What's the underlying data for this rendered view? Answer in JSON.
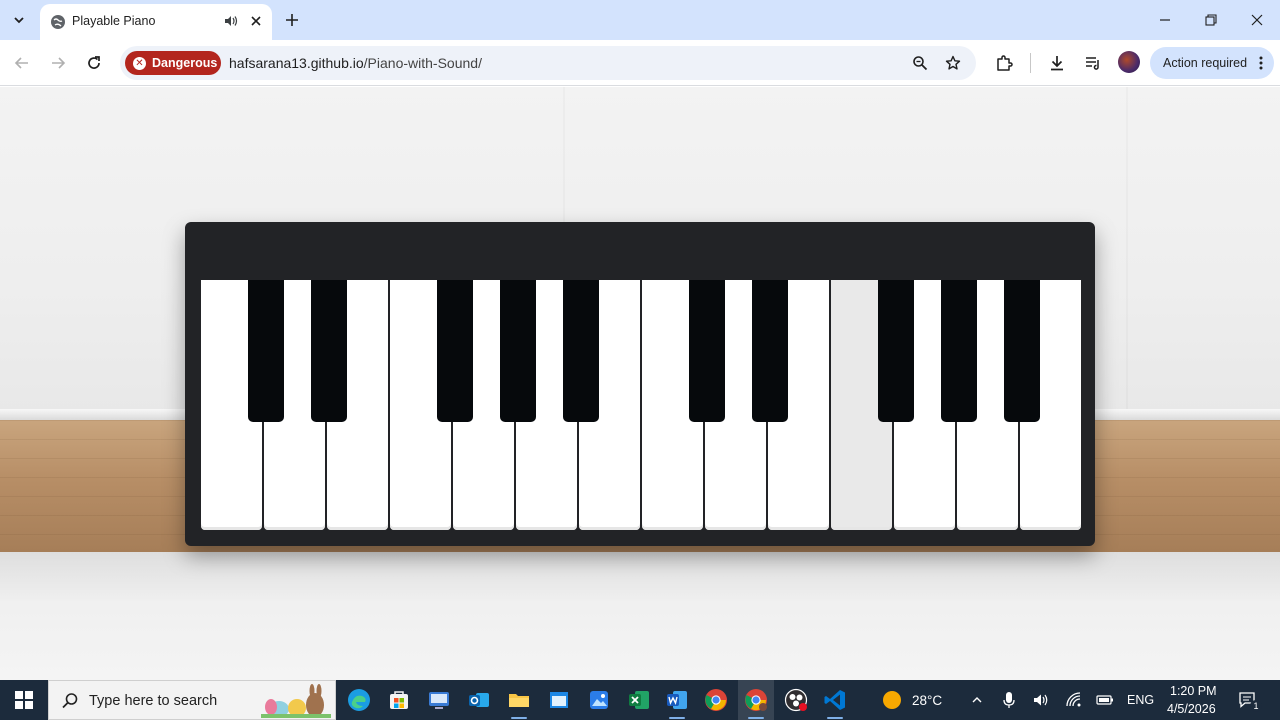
{
  "browser": {
    "tab": {
      "title": "Playable Piano"
    },
    "omnibox": {
      "security_label": "Dangerous",
      "url_host": "hafsarana13.github.io",
      "url_path": "/Piano-with-Sound/"
    },
    "action_pill": {
      "label": "Action required"
    }
  },
  "piano": {
    "white_keys": 14,
    "black_key_positions": [
      0,
      1,
      3,
      4,
      5,
      7,
      8,
      10,
      11,
      12
    ],
    "active_white_key": 10,
    "colors": {
      "body": "#222326",
      "white_key": "#ffffff",
      "black_key": "#06090c",
      "active_key": "#e9e9e9"
    }
  },
  "taskbar": {
    "search_placeholder": "Type here to search",
    "weather": "28°C",
    "language": "ENG",
    "time": "1:20 PM",
    "date": "4/5/2026",
    "notification_count": "1"
  }
}
